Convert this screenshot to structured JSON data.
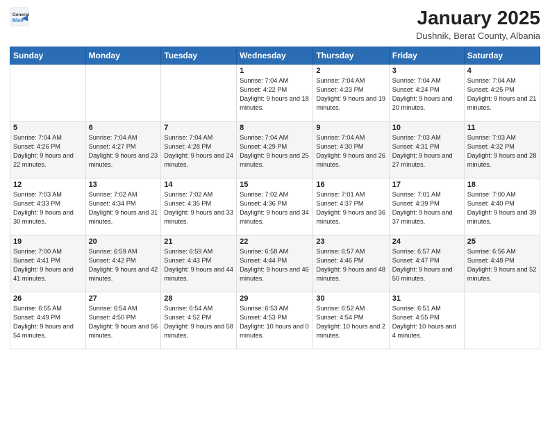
{
  "logo": {
    "general": "General",
    "blue": "Blue"
  },
  "header": {
    "month": "January 2025",
    "location": "Dushnik, Berat County, Albania"
  },
  "weekdays": [
    "Sunday",
    "Monday",
    "Tuesday",
    "Wednesday",
    "Thursday",
    "Friday",
    "Saturday"
  ],
  "weeks": [
    [
      {
        "day": "",
        "sunrise": "",
        "sunset": "",
        "daylight": ""
      },
      {
        "day": "",
        "sunrise": "",
        "sunset": "",
        "daylight": ""
      },
      {
        "day": "",
        "sunrise": "",
        "sunset": "",
        "daylight": ""
      },
      {
        "day": "1",
        "sunrise": "Sunrise: 7:04 AM",
        "sunset": "Sunset: 4:22 PM",
        "daylight": "Daylight: 9 hours and 18 minutes."
      },
      {
        "day": "2",
        "sunrise": "Sunrise: 7:04 AM",
        "sunset": "Sunset: 4:23 PM",
        "daylight": "Daylight: 9 hours and 19 minutes."
      },
      {
        "day": "3",
        "sunrise": "Sunrise: 7:04 AM",
        "sunset": "Sunset: 4:24 PM",
        "daylight": "Daylight: 9 hours and 20 minutes."
      },
      {
        "day": "4",
        "sunrise": "Sunrise: 7:04 AM",
        "sunset": "Sunset: 4:25 PM",
        "daylight": "Daylight: 9 hours and 21 minutes."
      }
    ],
    [
      {
        "day": "5",
        "sunrise": "Sunrise: 7:04 AM",
        "sunset": "Sunset: 4:26 PM",
        "daylight": "Daylight: 9 hours and 22 minutes."
      },
      {
        "day": "6",
        "sunrise": "Sunrise: 7:04 AM",
        "sunset": "Sunset: 4:27 PM",
        "daylight": "Daylight: 9 hours and 23 minutes."
      },
      {
        "day": "7",
        "sunrise": "Sunrise: 7:04 AM",
        "sunset": "Sunset: 4:28 PM",
        "daylight": "Daylight: 9 hours and 24 minutes."
      },
      {
        "day": "8",
        "sunrise": "Sunrise: 7:04 AM",
        "sunset": "Sunset: 4:29 PM",
        "daylight": "Daylight: 9 hours and 25 minutes."
      },
      {
        "day": "9",
        "sunrise": "Sunrise: 7:04 AM",
        "sunset": "Sunset: 4:30 PM",
        "daylight": "Daylight: 9 hours and 26 minutes."
      },
      {
        "day": "10",
        "sunrise": "Sunrise: 7:03 AM",
        "sunset": "Sunset: 4:31 PM",
        "daylight": "Daylight: 9 hours and 27 minutes."
      },
      {
        "day": "11",
        "sunrise": "Sunrise: 7:03 AM",
        "sunset": "Sunset: 4:32 PM",
        "daylight": "Daylight: 9 hours and 28 minutes."
      }
    ],
    [
      {
        "day": "12",
        "sunrise": "Sunrise: 7:03 AM",
        "sunset": "Sunset: 4:33 PM",
        "daylight": "Daylight: 9 hours and 30 minutes."
      },
      {
        "day": "13",
        "sunrise": "Sunrise: 7:02 AM",
        "sunset": "Sunset: 4:34 PM",
        "daylight": "Daylight: 9 hours and 31 minutes."
      },
      {
        "day": "14",
        "sunrise": "Sunrise: 7:02 AM",
        "sunset": "Sunset: 4:35 PM",
        "daylight": "Daylight: 9 hours and 33 minutes."
      },
      {
        "day": "15",
        "sunrise": "Sunrise: 7:02 AM",
        "sunset": "Sunset: 4:36 PM",
        "daylight": "Daylight: 9 hours and 34 minutes."
      },
      {
        "day": "16",
        "sunrise": "Sunrise: 7:01 AM",
        "sunset": "Sunset: 4:37 PM",
        "daylight": "Daylight: 9 hours and 36 minutes."
      },
      {
        "day": "17",
        "sunrise": "Sunrise: 7:01 AM",
        "sunset": "Sunset: 4:39 PM",
        "daylight": "Daylight: 9 hours and 37 minutes."
      },
      {
        "day": "18",
        "sunrise": "Sunrise: 7:00 AM",
        "sunset": "Sunset: 4:40 PM",
        "daylight": "Daylight: 9 hours and 39 minutes."
      }
    ],
    [
      {
        "day": "19",
        "sunrise": "Sunrise: 7:00 AM",
        "sunset": "Sunset: 4:41 PM",
        "daylight": "Daylight: 9 hours and 41 minutes."
      },
      {
        "day": "20",
        "sunrise": "Sunrise: 6:59 AM",
        "sunset": "Sunset: 4:42 PM",
        "daylight": "Daylight: 9 hours and 42 minutes."
      },
      {
        "day": "21",
        "sunrise": "Sunrise: 6:59 AM",
        "sunset": "Sunset: 4:43 PM",
        "daylight": "Daylight: 9 hours and 44 minutes."
      },
      {
        "day": "22",
        "sunrise": "Sunrise: 6:58 AM",
        "sunset": "Sunset: 4:44 PM",
        "daylight": "Daylight: 9 hours and 46 minutes."
      },
      {
        "day": "23",
        "sunrise": "Sunrise: 6:57 AM",
        "sunset": "Sunset: 4:46 PM",
        "daylight": "Daylight: 9 hours and 48 minutes."
      },
      {
        "day": "24",
        "sunrise": "Sunrise: 6:57 AM",
        "sunset": "Sunset: 4:47 PM",
        "daylight": "Daylight: 9 hours and 50 minutes."
      },
      {
        "day": "25",
        "sunrise": "Sunrise: 6:56 AM",
        "sunset": "Sunset: 4:48 PM",
        "daylight": "Daylight: 9 hours and 52 minutes."
      }
    ],
    [
      {
        "day": "26",
        "sunrise": "Sunrise: 6:55 AM",
        "sunset": "Sunset: 4:49 PM",
        "daylight": "Daylight: 9 hours and 54 minutes."
      },
      {
        "day": "27",
        "sunrise": "Sunrise: 6:54 AM",
        "sunset": "Sunset: 4:50 PM",
        "daylight": "Daylight: 9 hours and 56 minutes."
      },
      {
        "day": "28",
        "sunrise": "Sunrise: 6:54 AM",
        "sunset": "Sunset: 4:52 PM",
        "daylight": "Daylight: 9 hours and 58 minutes."
      },
      {
        "day": "29",
        "sunrise": "Sunrise: 6:53 AM",
        "sunset": "Sunset: 4:53 PM",
        "daylight": "Daylight: 10 hours and 0 minutes."
      },
      {
        "day": "30",
        "sunrise": "Sunrise: 6:52 AM",
        "sunset": "Sunset: 4:54 PM",
        "daylight": "Daylight: 10 hours and 2 minutes."
      },
      {
        "day": "31",
        "sunrise": "Sunrise: 6:51 AM",
        "sunset": "Sunset: 4:55 PM",
        "daylight": "Daylight: 10 hours and 4 minutes."
      },
      {
        "day": "",
        "sunrise": "",
        "sunset": "",
        "daylight": ""
      }
    ]
  ]
}
